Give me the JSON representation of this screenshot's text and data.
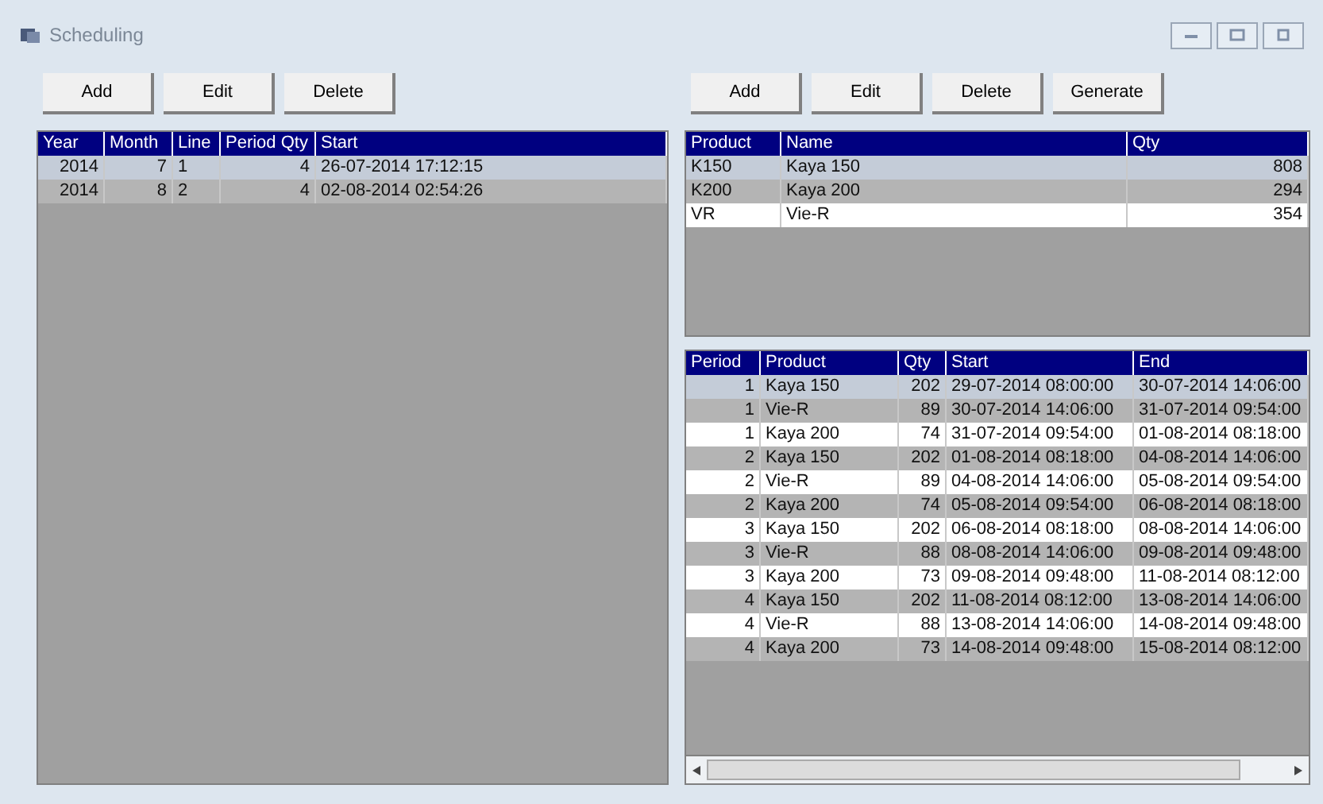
{
  "window": {
    "title": "Scheduling"
  },
  "left": {
    "buttons": [
      "Add",
      "Edit",
      "Delete"
    ],
    "table": {
      "columns": [
        "Year",
        "Month",
        "Line",
        "Period Qty",
        "Start"
      ],
      "rows": [
        {
          "cells": [
            "2014",
            "7",
            "1",
            "4",
            "26-07-2014 17:12:15"
          ],
          "selected": true
        },
        {
          "cells": [
            "2014",
            "8",
            "2",
            "4",
            "02-08-2014 02:54:26"
          ],
          "selected": false
        }
      ]
    }
  },
  "right": {
    "buttons": [
      "Add",
      "Edit",
      "Delete",
      "Generate"
    ],
    "products": {
      "columns": [
        "Product",
        "Name",
        "Qty"
      ],
      "rows": [
        {
          "cells": [
            "K150",
            "Kaya 150",
            "808"
          ],
          "selected": true
        },
        {
          "cells": [
            "K200",
            "Kaya 200",
            "294"
          ],
          "selected": false
        },
        {
          "cells": [
            "VR",
            "Vie-R",
            "354"
          ],
          "selected": false
        }
      ]
    },
    "periods": {
      "columns": [
        "Period",
        "Product",
        "Qty",
        "Start",
        "End"
      ],
      "rows": [
        {
          "cells": [
            "1",
            "Kaya 150",
            "202",
            "29-07-2014 08:00:00",
            "30-07-2014 14:06:00"
          ],
          "selected": true
        },
        {
          "cells": [
            "1",
            "Vie-R",
            "89",
            "30-07-2014 14:06:00",
            "31-07-2014 09:54:00"
          ],
          "selected": false
        },
        {
          "cells": [
            "1",
            "Kaya 200",
            "74",
            "31-07-2014 09:54:00",
            "01-08-2014 08:18:00"
          ],
          "selected": false
        },
        {
          "cells": [
            "2",
            "Kaya 150",
            "202",
            "01-08-2014 08:18:00",
            "04-08-2014 14:06:00"
          ],
          "selected": false
        },
        {
          "cells": [
            "2",
            "Vie-R",
            "89",
            "04-08-2014 14:06:00",
            "05-08-2014 09:54:00"
          ],
          "selected": false
        },
        {
          "cells": [
            "2",
            "Kaya 200",
            "74",
            "05-08-2014 09:54:00",
            "06-08-2014 08:18:00"
          ],
          "selected": false
        },
        {
          "cells": [
            "3",
            "Kaya 150",
            "202",
            "06-08-2014 08:18:00",
            "08-08-2014 14:06:00"
          ],
          "selected": false
        },
        {
          "cells": [
            "3",
            "Vie-R",
            "88",
            "08-08-2014 14:06:00",
            "09-08-2014 09:48:00"
          ],
          "selected": false
        },
        {
          "cells": [
            "3",
            "Kaya 200",
            "73",
            "09-08-2014 09:48:00",
            "11-08-2014 08:12:00"
          ],
          "selected": false
        },
        {
          "cells": [
            "4",
            "Kaya 150",
            "202",
            "11-08-2014 08:12:00",
            "13-08-2014 14:06:00"
          ],
          "selected": false
        },
        {
          "cells": [
            "4",
            "Vie-R",
            "88",
            "13-08-2014 14:06:00",
            "14-08-2014 09:48:00"
          ],
          "selected": false
        },
        {
          "cells": [
            "4",
            "Kaya 200",
            "73",
            "14-08-2014 09:48:00",
            "15-08-2014 08:12:00"
          ],
          "selected": false
        }
      ]
    }
  }
}
